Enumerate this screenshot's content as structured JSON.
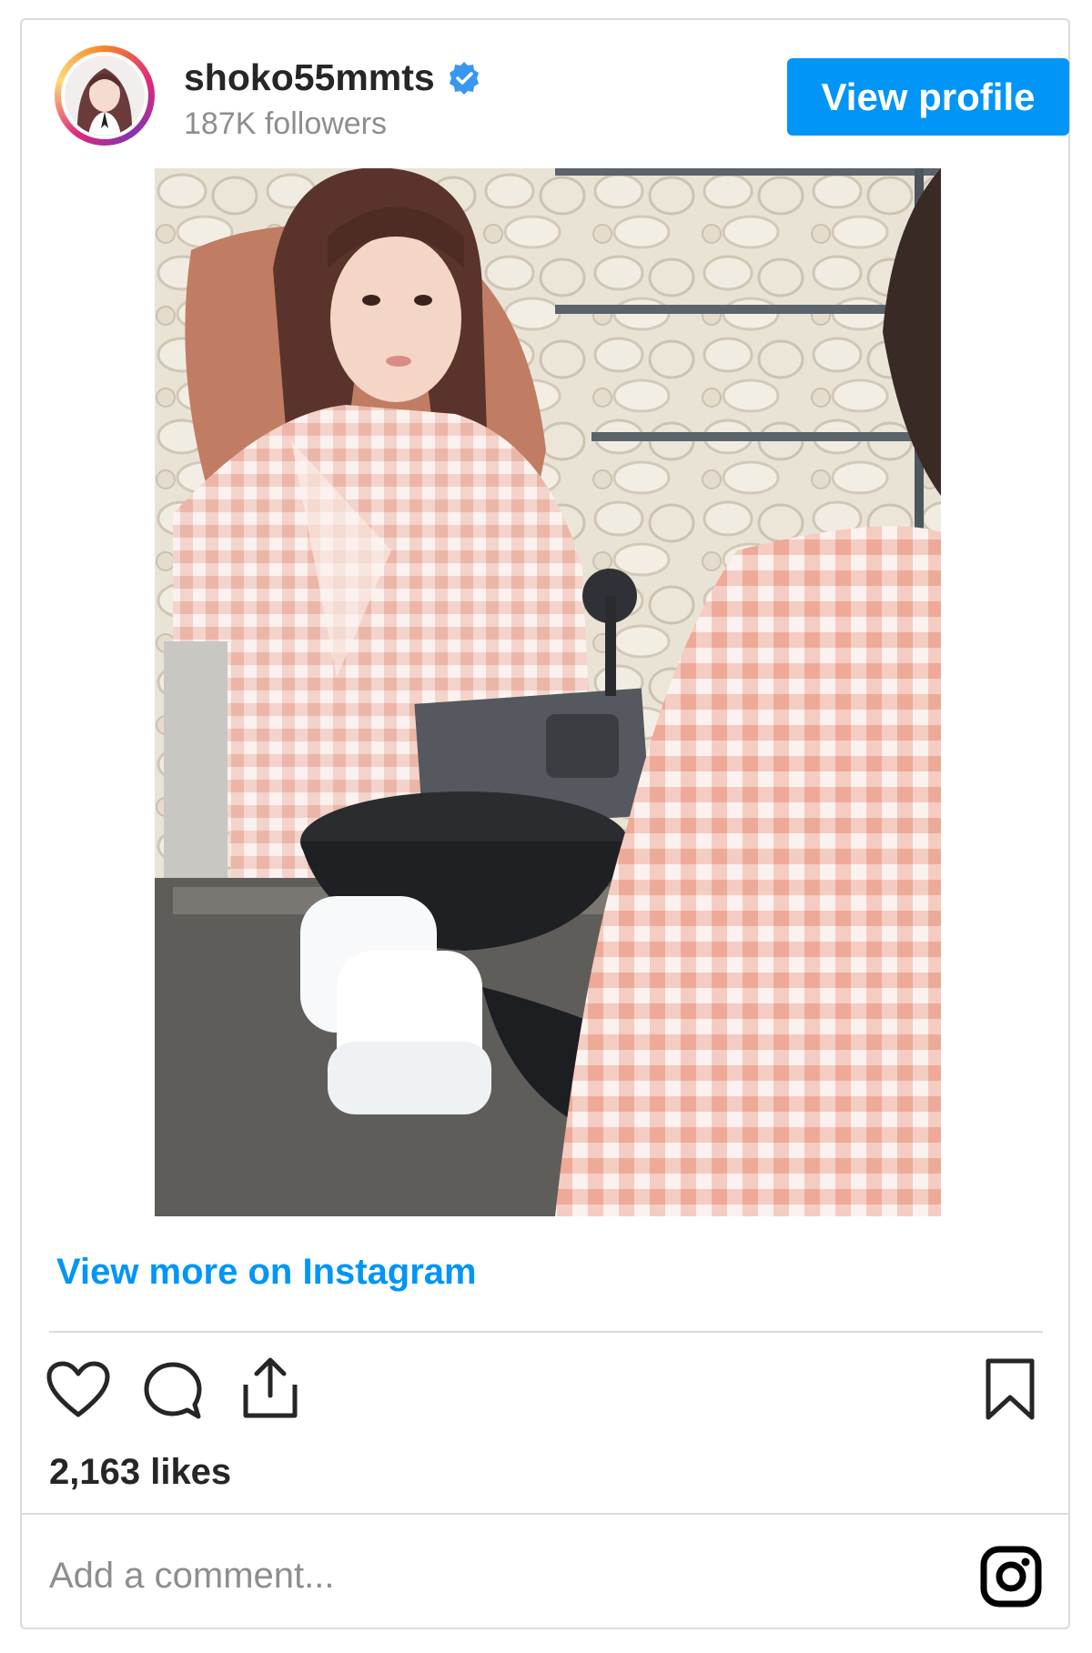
{
  "post": {
    "username": "shoko55mmts",
    "followers": "187K followers",
    "view_profile_label": "View profile",
    "view_more_label": "View more on Instagram",
    "likes": "2,163 likes",
    "comment_placeholder": "Add a comment..."
  },
  "icons": {
    "verified": "verified-badge-icon",
    "like": "heart-icon",
    "comment": "comment-bubble-icon",
    "share": "share-icon",
    "save": "bookmark-icon",
    "brand": "instagram-logo-icon"
  },
  "colors": {
    "accent": "#0095f6",
    "text": "#262626",
    "muted": "#8e8e8e",
    "border": "#dbdbdb"
  }
}
